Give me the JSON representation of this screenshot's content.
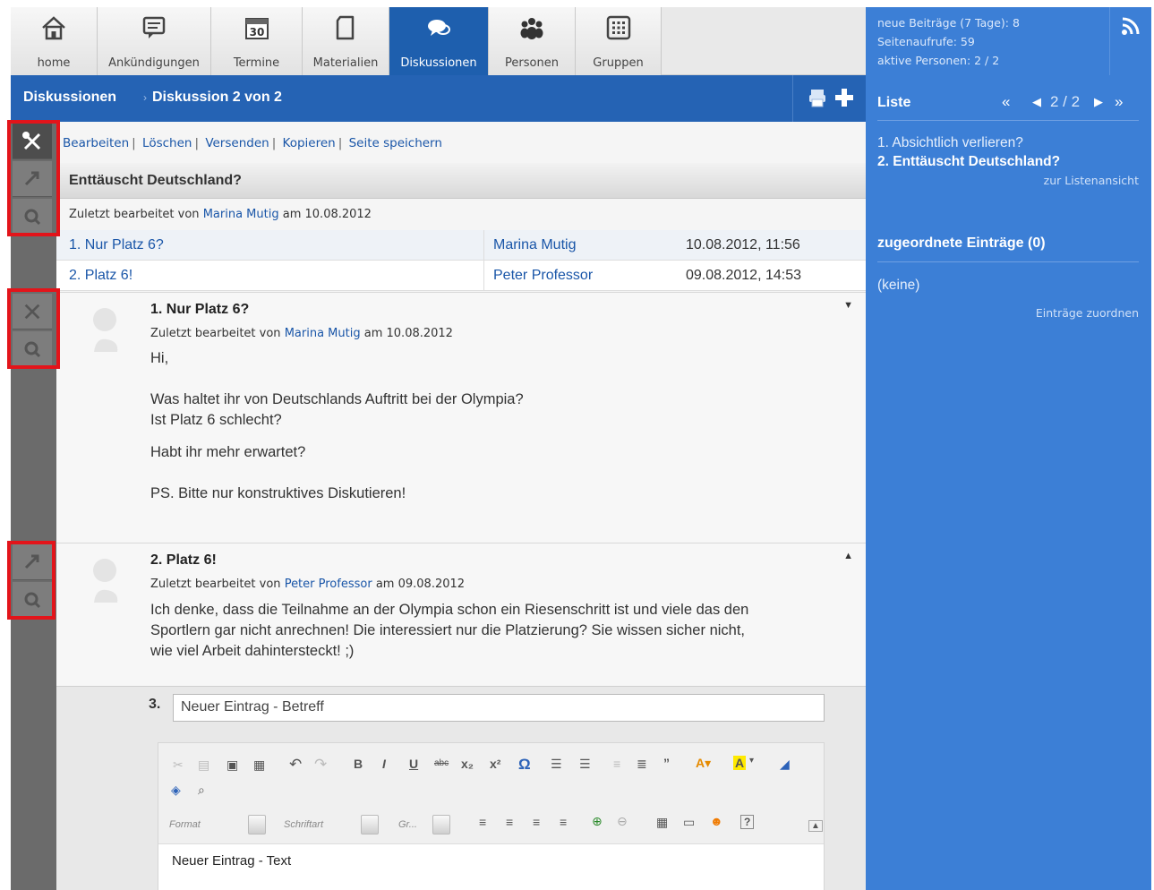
{
  "nav": {
    "tabs": [
      {
        "label": "home",
        "icon": "home-icon"
      },
      {
        "label": "Ankündigungen",
        "icon": "announcement-icon"
      },
      {
        "label": "Termine",
        "icon": "calendar-icon"
      },
      {
        "label": "Materialien",
        "icon": "document-icon"
      },
      {
        "label": "Diskussionen",
        "icon": "discussion-icon"
      },
      {
        "label": "Personen",
        "icon": "people-icon"
      },
      {
        "label": "Gruppen",
        "icon": "groups-icon"
      }
    ],
    "calendar_day": "30",
    "active": "Diskussionen"
  },
  "stats": {
    "line1": "neue Beiträge (7 Tage): 8",
    "line2": "Seitenaufrufe: 59",
    "line3": "aktive Personen: 2 / 2"
  },
  "breadcrumb": {
    "root": "Diskussionen",
    "current": "Diskussion 2 von 2"
  },
  "actions": [
    "Bearbeiten",
    "Löschen",
    "Versenden",
    "Kopieren",
    "Seite speichern"
  ],
  "discussion": {
    "title": "Enttäuscht Deutschland?",
    "meta_prefix": "Zuletzt bearbeitet von",
    "author": "Marina Mutig",
    "meta_mid": "am",
    "date": "10.08.2012",
    "toc": [
      {
        "title": "1. Nur Platz 6?",
        "author": "Marina Mutig",
        "date": "10.08.2012, 11:56"
      },
      {
        "title": "2. Platz 6!",
        "author": "Peter Professor",
        "date": "09.08.2012, 14:53"
      }
    ]
  },
  "entries": [
    {
      "title": "1. Nur Platz 6?",
      "author": "Marina Mutig",
      "date": "10.08.2012",
      "lines": [
        "Hi,",
        "Was haltet ihr von Deutschlands Auftritt bei der Olympia?",
        "Ist Platz 6 schlecht?",
        "Habt ihr mehr erwartet?",
        "PS. Bitte nur konstruktives Diskutieren!"
      ]
    },
    {
      "title": "2. Platz 6!",
      "author": "Peter Professor",
      "date": "09.08.2012",
      "lines": [
        "Ich denke, dass die Teilnahme an der Olympia schon ein Riesenschritt ist und viele das den",
        "Sportlern gar nicht anrechnen! Die interessiert nur die Platzierung? Sie wissen sicher nicht,",
        "wie viel Arbeit dahintersteckt! ;)"
      ]
    }
  ],
  "new_entry": {
    "number": "3.",
    "subject_value": "Neuer Eintrag - Betreff",
    "text_value": "Neuer Eintrag - Text",
    "format_label": "Format",
    "font_label": "Schriftart",
    "size_label": "Gr..."
  },
  "right": {
    "list_title": "Liste",
    "pager": "2 / 2",
    "items": [
      "1. Absichtlich verlieren?",
      "2. Enttäuscht Deutschland?"
    ],
    "list_view_link": "zur Listenansicht",
    "assigned_title": "zugeordnete Einträge (0)",
    "none_text": "(keine)",
    "assign_link": "Einträge zuordnen"
  },
  "colors": {
    "nav_active": "#1e5fae",
    "right_panel": "#3c7fd6",
    "highlight": "#e3141a"
  }
}
